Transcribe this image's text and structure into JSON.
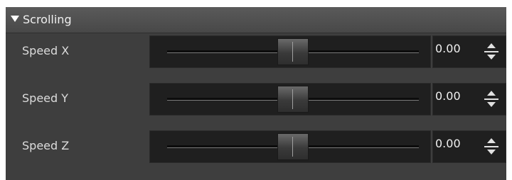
{
  "section": {
    "title": "Scrolling",
    "expanded": true,
    "icon": "triangle-down-icon"
  },
  "rows": [
    {
      "label": "Speed X",
      "value": "0.00",
      "slider_level": 0.5
    },
    {
      "label": "Speed Y",
      "value": "0.00",
      "slider_level": 0.5
    },
    {
      "label": "Speed Z",
      "value": "0.00",
      "slider_level": 0.5
    }
  ],
  "icons": {
    "spinner_up": "spin-up-arrow-icon",
    "spinner_down": "spin-down-arrow-icon"
  }
}
